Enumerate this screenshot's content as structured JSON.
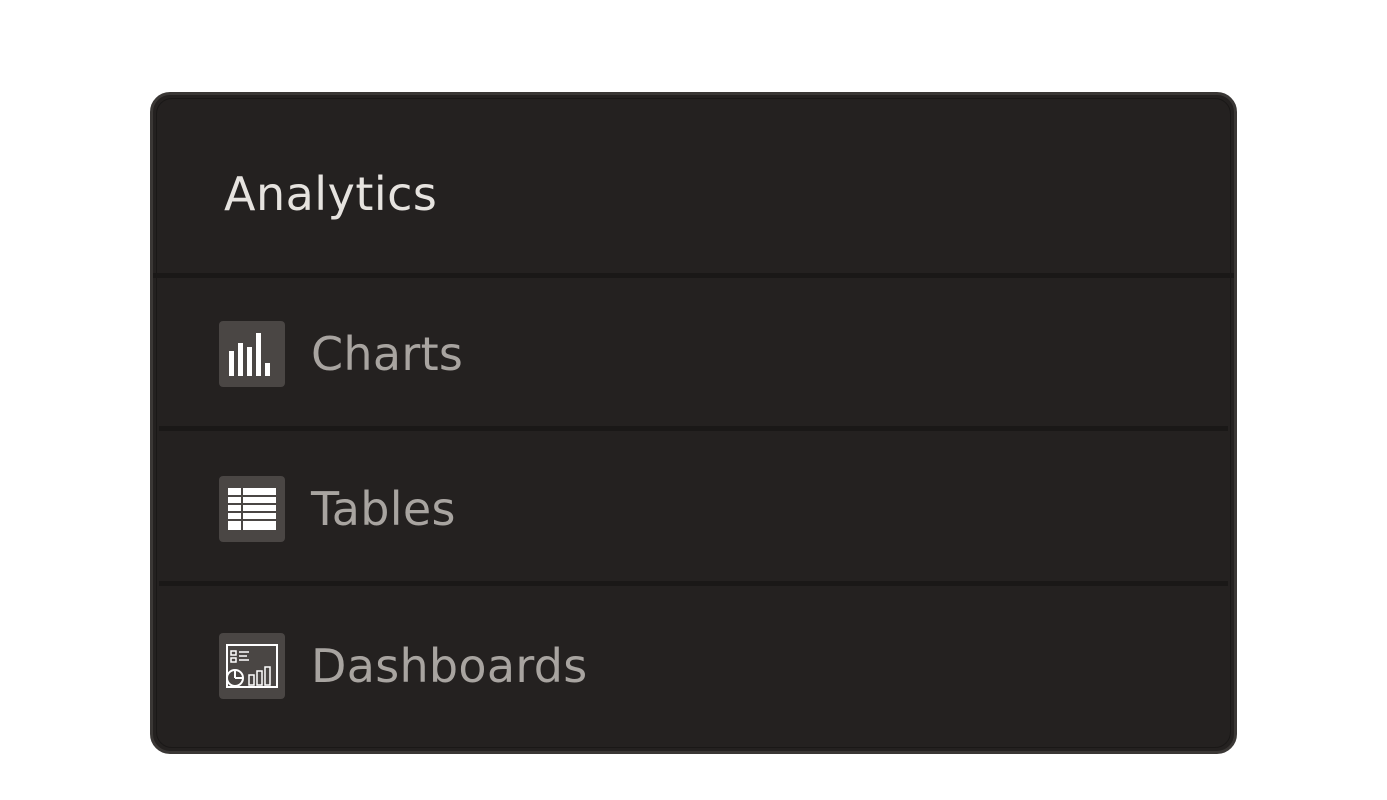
{
  "menu": {
    "title": "Analytics",
    "items": [
      {
        "label": "Charts",
        "icon": "bar-chart-icon"
      },
      {
        "label": "Tables",
        "icon": "table-icon"
      },
      {
        "label": "Dashboards",
        "icon": "dashboard-icon"
      }
    ]
  },
  "colors": {
    "panel_background": "#242120",
    "title_text": "#e6e3df",
    "item_text": "#a8a4a0",
    "icon_background": "#4a4644"
  }
}
